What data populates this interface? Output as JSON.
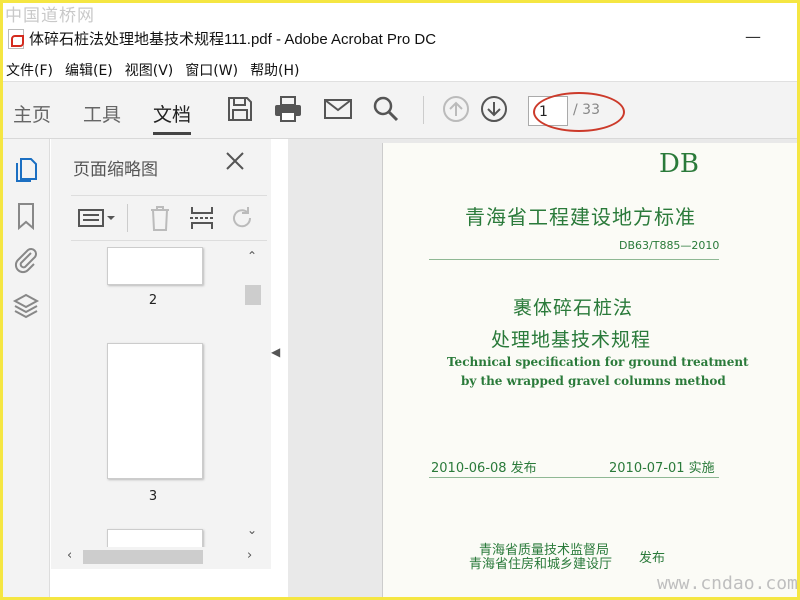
{
  "watermark_top": "中国道桥网",
  "watermark_bottom": "www.cndao.com",
  "window": {
    "title": "体碎石桩法处理地基技术规程111.pdf - Adobe Acrobat Pro DC",
    "minimize": "—"
  },
  "menu": [
    "文件(F)",
    "编辑(E)",
    "视图(V)",
    "窗口(W)",
    "帮助(H)"
  ],
  "toolbar": {
    "tabs": [
      "主页",
      "工具",
      "文档"
    ],
    "icons": [
      "save-icon",
      "print-icon",
      "email-icon",
      "search-icon",
      "page-up-icon",
      "page-down-icon"
    ],
    "page_current": "1",
    "page_total": "/ 33"
  },
  "rail_icons": [
    "pages-icon",
    "bookmark-icon",
    "attachment-icon",
    "layers-icon"
  ],
  "panel": {
    "title": "页面缩略图",
    "tools": [
      "thumbnail-options-icon",
      "delete-icon",
      "insert-pages-icon",
      "rotate-icon"
    ],
    "thumbnails": [
      {
        "label": "2"
      },
      {
        "label": "3"
      }
    ]
  },
  "document": {
    "code": "DB",
    "title": "青海省工程建设地方标准",
    "std_number": "DB63/T885—2010",
    "heading1": "裹体碎石桩法",
    "heading2": "处理地基技术规程",
    "english1": "Technical specification for ground treatment",
    "english2": "by the wrapped gravel columns method",
    "issue_date": "2010-06-08 发布",
    "impl_date": "2010-07-01 实施",
    "issuer1": "青海省质量技术监督局",
    "issuer2": "青海省住房和城乡建设厅",
    "publish": "发布"
  },
  "colors": {
    "accent_blue": "#1b6fc2",
    "doc_green": "#2a7a3a",
    "highlight_red": "#cc3a2a"
  }
}
